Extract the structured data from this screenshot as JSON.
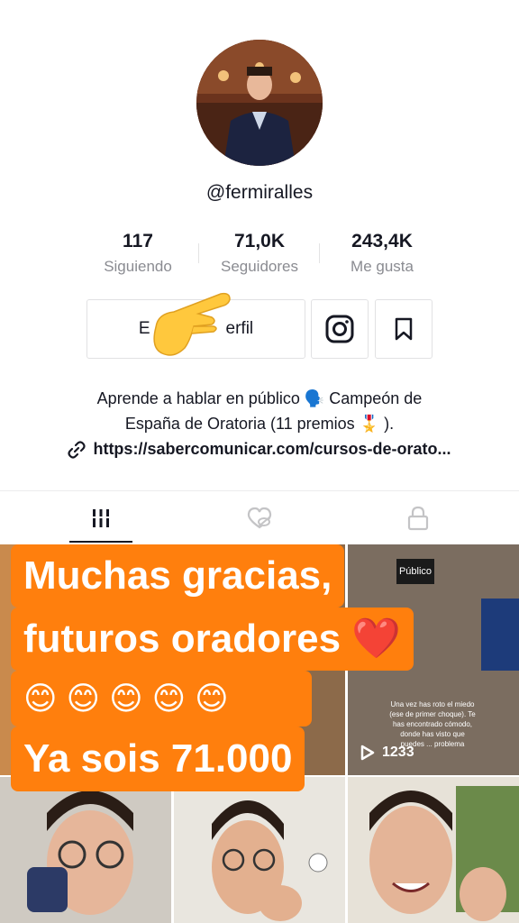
{
  "profile": {
    "username": "@fermiralles",
    "stats": [
      {
        "value": "117",
        "label": "Siguiendo"
      },
      {
        "value": "71,0K",
        "label": "Seguidores"
      },
      {
        "value": "243,4K",
        "label": "Me gusta"
      }
    ],
    "edit_button_label": "Editar perfil",
    "edit_visible_prefix": "E",
    "edit_visible_suffix": "erfil",
    "bio_line1": "Aprende a hablar en público 🗣️ Campeón de",
    "bio_line2": "España de Oratoria (11 premios 🎖️ ).",
    "link": "https://sabercomunicar.com/cursos-de-orato..."
  },
  "tabs": [
    {
      "name": "videos",
      "icon": "grid-icon",
      "active": true
    },
    {
      "name": "liked",
      "icon": "liked-hidden-icon",
      "active": false
    },
    {
      "name": "private",
      "icon": "lock-icon",
      "active": false
    }
  ],
  "overlay": {
    "line1": "Muchas gracias,",
    "line2": "futuros oradores ❤️",
    "line3": "😊 😊 😊 😊 😊",
    "line4": "Ya sois 71.000",
    "color": "#ff7f0d"
  },
  "grid": {
    "top_right_badge": "Público",
    "video_caption": "Una vez has roto el miedo (ese de primer choque). Te has encontrado cómodo, donde has visto que puedes ... problema",
    "view_count": "1233"
  },
  "colors": {
    "text": "#161823",
    "muted": "#8a8b91",
    "border": "#e1e1e3"
  }
}
